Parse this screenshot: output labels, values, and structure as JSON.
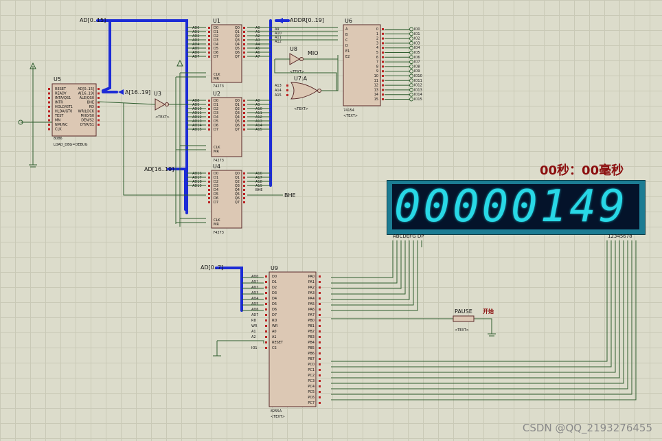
{
  "timer": {
    "label": "00秒：00毫秒"
  },
  "display": {
    "digits": "00000149",
    "segment_pins": "ABCDEFG DP",
    "digit_pins": "12345678",
    "color": "#28d8e6",
    "frame_color": "#1c7c93"
  },
  "chips": {
    "u1": {
      "ref": "U1",
      "type": "74273"
    },
    "u2": {
      "ref": "U2",
      "type": "74273"
    },
    "u4": {
      "ref": "U4",
      "type": "74273"
    },
    "u3": {
      "ref": "U3",
      "type": "NOT",
      "text": "<TEXT>"
    },
    "u5": {
      "ref": "U5",
      "type": "8086",
      "sub": "LOAD_DBG=DEBUG"
    },
    "u6": {
      "ref": "U6",
      "type": "74154",
      "text": "<TEXT>"
    },
    "u7": {
      "ref": "U7:A",
      "type": "7427",
      "text": "<TEXT>"
    },
    "u8": {
      "ref": "U8",
      "type": "NOT",
      "text": "<TEXT>"
    },
    "u9": {
      "ref": "U9",
      "type": "8255A",
      "text": "<TEXT>"
    }
  },
  "u5_pins_left": [
    "RESET",
    "READY",
    "INTA/QS1",
    "INTR",
    "HOLD/GT1",
    "HLDA/GT0",
    "TEST",
    "MN",
    "NMI/NC",
    "CLK"
  ],
  "u5_pins_right": [
    "AD[0..15]",
    "A[16..19]",
    "ALE/QS0",
    "BHE",
    "RD",
    "WR/LOCK",
    "M/IO/S0",
    "DEN/S2",
    "DT/R/S1"
  ],
  "buses": {
    "ad_top": "AD[0..15]",
    "a16": "A[16..19]",
    "addr": "ADDR[0..19]",
    "a1619": "AD[16..19]",
    "ad07": "AD[0..7]"
  },
  "u1_in": [
    "AD0",
    "AD1",
    "AD2",
    "AD3",
    "AD4",
    "AD5",
    "AD6",
    "AD7"
  ],
  "u1_out": [
    "A0",
    "A1",
    "A2",
    "A3",
    "A4",
    "A5",
    "A6",
    "A7"
  ],
  "u2_in": [
    "AD8",
    "AD9",
    "AD10",
    "AD11",
    "AD12",
    "AD13",
    "AD14",
    "AD15"
  ],
  "u2_out": [
    "A8",
    "A9",
    "A10",
    "A11",
    "A12",
    "A13",
    "A14",
    "A15"
  ],
  "u4_in": [
    "AD16",
    "AD17",
    "AD18",
    "AD19"
  ],
  "u4_out": [
    "A16",
    "A17",
    "A18",
    "A19",
    "BHE"
  ],
  "ff_pins": [
    "D0",
    "D1",
    "D2",
    "D3",
    "D4",
    "D5",
    "D6",
    "D7"
  ],
  "ff_out": [
    "Q0",
    "Q1",
    "Q2",
    "Q3",
    "Q4",
    "Q5",
    "Q6",
    "Q7"
  ],
  "u6_in": [
    "A9",
    "A10",
    "A11",
    "A12"
  ],
  "u6_addr_pins": [
    "A",
    "B",
    "C",
    "D",
    "E1",
    "E2"
  ],
  "u6_out": [
    "IO0",
    "IO1",
    "IO2",
    "IO3",
    "IO4",
    "IO5",
    "IO6",
    "IO7",
    "IO8",
    "IO9",
    "IO10",
    "IO11",
    "IO12",
    "IO13",
    "IO14",
    "IO15"
  ],
  "u7_in": [
    "A13",
    "A14",
    "A15"
  ],
  "u9_left": [
    "D0",
    "D1",
    "D2",
    "D3",
    "D4",
    "D5",
    "D6",
    "D7",
    "RD",
    "WR",
    "A0",
    "A1",
    "RESET",
    "CS"
  ],
  "u9_left_nets": [
    "AD0",
    "AD1",
    "AD2",
    "AD3",
    "AD4",
    "AD5",
    "AD6",
    "AD7",
    "RD",
    "WR",
    "A1",
    "A2",
    "",
    "IO1"
  ],
  "u9_right": [
    "PA0",
    "PA1",
    "PA2",
    "PA3",
    "PA4",
    "PA5",
    "PA6",
    "PA7",
    "PB0",
    "PB1",
    "PB2",
    "PB3",
    "PB4",
    "PB5",
    "PB6",
    "PB7",
    "PC0",
    "PC1",
    "PC2",
    "PC3",
    "PC4",
    "PC5",
    "PC6",
    "PC7"
  ],
  "nets": {
    "rd": "RD",
    "wr": "WR",
    "mio": "MIO",
    "io1": "IO1",
    "bhe": "BHE"
  },
  "pause": {
    "label": "PAUSE",
    "start": "开始",
    "text": "<TEXT>"
  },
  "watermark": "CSDN @QQ_2193276455"
}
